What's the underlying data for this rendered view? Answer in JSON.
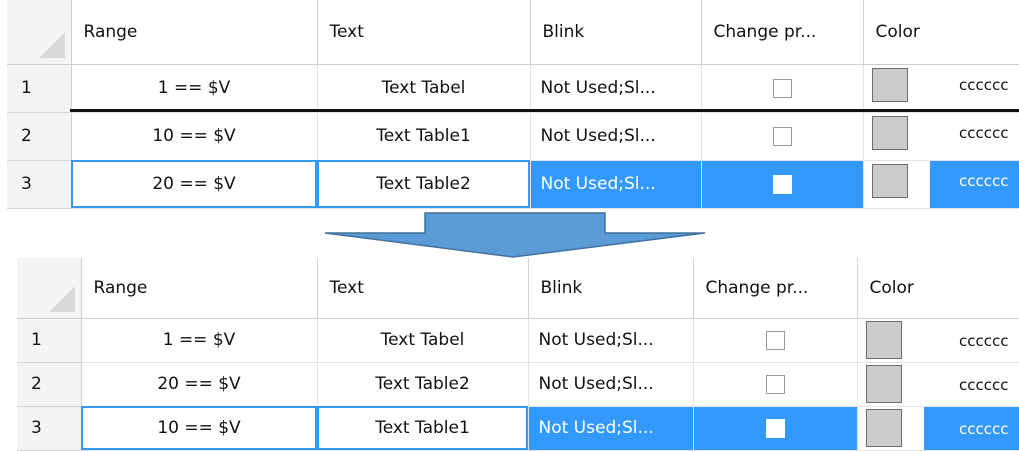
{
  "grids": [
    {
      "headers": {
        "range": "Range",
        "text": "Text",
        "blink": "Blink",
        "change": "Change pr...",
        "color": "Color"
      },
      "rows": [
        {
          "num": "1",
          "range": "1 == $V",
          "text": "Text Tabel",
          "blink": "Not Used;Sl...",
          "color_hex": "cccccc"
        },
        {
          "num": "2",
          "range": "10 == $V",
          "text": "Text Table1",
          "blink": "Not Used;Sl...",
          "color_hex": "cccccc"
        },
        {
          "num": "3",
          "range": "20 == $V",
          "text": "Text Table2",
          "blink": "Not Used;Sl...",
          "color_hex": "cccccc"
        }
      ]
    },
    {
      "headers": {
        "range": "Range",
        "text": "Text",
        "blink": "Blink",
        "change": "Change pr...",
        "color": "Color"
      },
      "rows": [
        {
          "num": "1",
          "range": "1 == $V",
          "text": "Text Tabel",
          "blink": "Not Used;Sl...",
          "color_hex": "cccccc"
        },
        {
          "num": "2",
          "range": "20 == $V",
          "text": "Text Table2",
          "blink": "Not Used;Sl...",
          "color_hex": "cccccc"
        },
        {
          "num": "3",
          "range": "10 == $V",
          "text": "Text Table1",
          "blink": "Not Used;Sl...",
          "color_hex": "cccccc"
        }
      ]
    }
  ],
  "colors": {
    "selection": "#3399ff",
    "swatch": "#cccccc",
    "arrow_fill": "#5b9bd5",
    "arrow_stroke": "#41719c"
  },
  "arrow": {
    "direction": "down"
  }
}
